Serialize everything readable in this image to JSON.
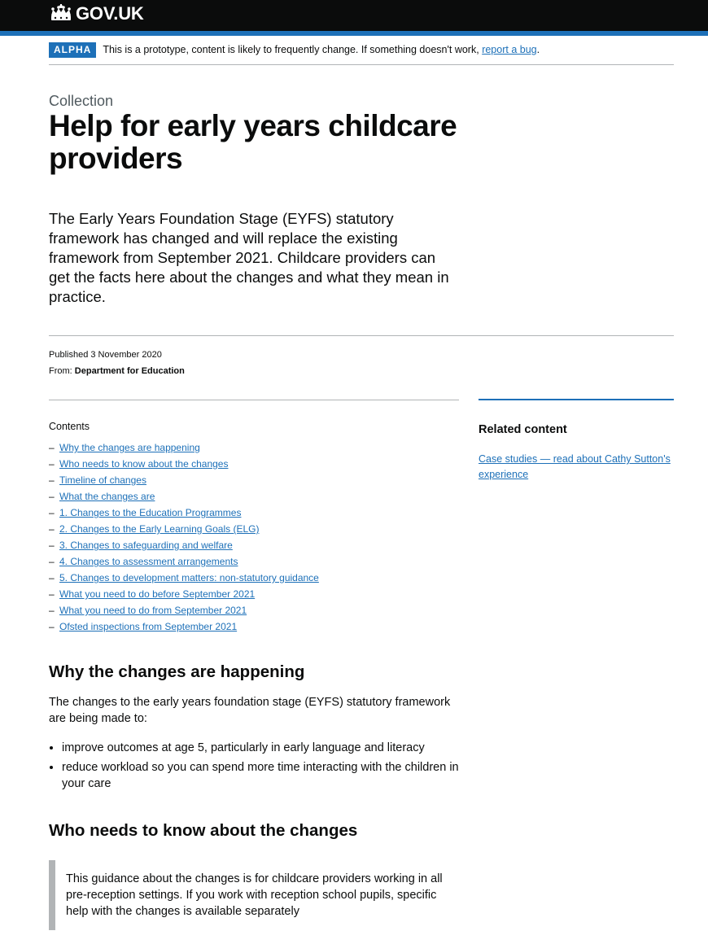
{
  "header": {
    "logo_text": "GOV.UK"
  },
  "phase_banner": {
    "tag": "ALPHA",
    "text": "This is a prototype, content is likely to frequently change. If something doesn't work,",
    "link": "report a bug",
    "suffix": "."
  },
  "page": {
    "caption": "Collection",
    "title": "Help for early years childcare providers",
    "lead": "The Early Years Foundation Stage (EYFS) statutory framework has changed and will replace the existing framework from September 2021. Childcare providers can get the facts here about the changes and what they mean in practice."
  },
  "metadata": {
    "published": "Published 3 November 2020",
    "from_label": "From:",
    "from_org": "Department for Education"
  },
  "contents": {
    "title": "Contents",
    "dash": "–",
    "items": [
      "Why the changes are happening",
      "Who needs to know about the changes",
      "Timeline of changes",
      "What the changes are",
      "1. Changes to the Education Programmes",
      "2. Changes to the Early Learning Goals (ELG)",
      "3. Changes to safeguarding and welfare",
      "4. Changes to assessment arrangements",
      "5. Changes to development matters: non-statutory guidance",
      "What you need to do before September 2021",
      "What you need to do from September 2021",
      "Ofsted inspections from September 2021"
    ]
  },
  "related": {
    "title": "Related content",
    "link": "Case studies — read about Cathy Sutton's experience"
  },
  "sections": {
    "why": {
      "heading": "Why the changes are happening",
      "intro": "The changes to the early years foundation stage (EYFS) statutory framework are being made to:",
      "bullets": [
        "improve outcomes at age 5, particularly in early language and literacy",
        "reduce workload so you can spend more time interacting with the children in your care"
      ]
    },
    "who": {
      "heading": "Who needs to know about the changes",
      "inset": "This guidance about the changes is for childcare providers working in all pre-reception settings. If you work with reception school pupils, specific help with the changes is available separately"
    }
  },
  "colors": {
    "header_bg": "#0b0c0c",
    "brand_blue": "#1d70b8",
    "link": "#1d70b8",
    "rule_grey": "#b1b4b6",
    "caption_grey": "#505a5f"
  }
}
